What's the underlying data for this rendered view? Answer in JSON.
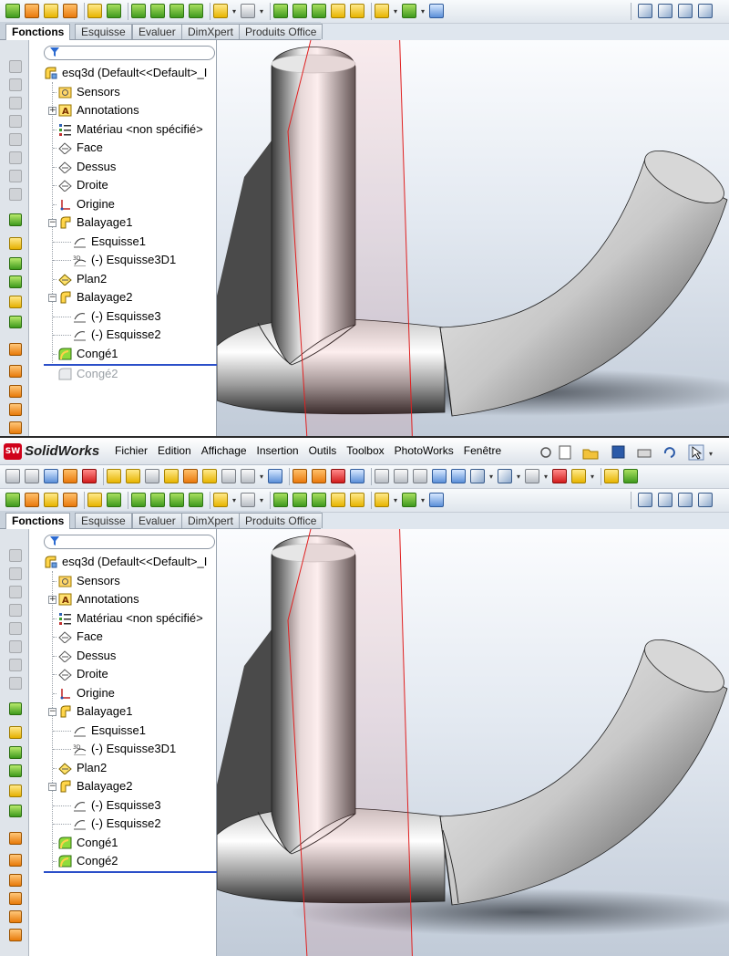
{
  "menubar": {
    "logo_mark": "SW",
    "app_name": "SolidWorks",
    "items": [
      "Fichier",
      "Edition",
      "Affichage",
      "Insertion",
      "Outils",
      "Toolbox",
      "PhotoWorks",
      "Fenêtre"
    ]
  },
  "command_manager": {
    "tabs": [
      "Fonctions",
      "Esquisse",
      "Evaluer",
      "DimXpert",
      "Produits Office"
    ],
    "active_tab": "Fonctions"
  },
  "feature_tree": {
    "root_label": "esq3d  (Default<<Default>_I",
    "top_panel_items": [
      {
        "label": "Sensors",
        "icon": "sensors-icon",
        "level": 1,
        "expander": ""
      },
      {
        "label": "Annotations",
        "icon": "annotations-icon",
        "level": 1,
        "expander": "+"
      },
      {
        "label": "Matériau <non spécifié>",
        "icon": "material-icon",
        "level": 1,
        "expander": ""
      },
      {
        "label": "Face",
        "icon": "plane-icon",
        "level": 1,
        "expander": ""
      },
      {
        "label": "Dessus",
        "icon": "plane-icon",
        "level": 1,
        "expander": ""
      },
      {
        "label": "Droite",
        "icon": "plane-icon",
        "level": 1,
        "expander": ""
      },
      {
        "label": "Origine",
        "icon": "origin-icon",
        "level": 1,
        "expander": ""
      },
      {
        "label": "Balayage1",
        "icon": "sweep-icon",
        "level": 1,
        "expander": "−"
      },
      {
        "label": "Esquisse1",
        "icon": "sketch-icon",
        "level": 2,
        "expander": ""
      },
      {
        "label": "(-) Esquisse3D1",
        "icon": "sketch3d-icon",
        "level": 2,
        "expander": ""
      },
      {
        "label": "Plan2",
        "icon": "plane-yellow-icon",
        "level": 1,
        "expander": ""
      },
      {
        "label": "Balayage2",
        "icon": "sweep-icon",
        "level": 1,
        "expander": "−"
      },
      {
        "label": "(-) Esquisse3",
        "icon": "sketch-icon",
        "level": 2,
        "expander": ""
      },
      {
        "label": "(-) Esquisse2",
        "icon": "sketch-icon",
        "level": 2,
        "expander": ""
      },
      {
        "label": "Congé1",
        "icon": "fillet-icon",
        "level": 1,
        "expander": ""
      }
    ],
    "top_panel_suppressed": "Congé2",
    "bottom_panel_items": [
      {
        "label": "Sensors",
        "icon": "sensors-icon",
        "level": 1,
        "expander": ""
      },
      {
        "label": "Annotations",
        "icon": "annotations-icon",
        "level": 1,
        "expander": "+"
      },
      {
        "label": "Matériau <non spécifié>",
        "icon": "material-icon",
        "level": 1,
        "expander": ""
      },
      {
        "label": "Face",
        "icon": "plane-icon",
        "level": 1,
        "expander": ""
      },
      {
        "label": "Dessus",
        "icon": "plane-icon",
        "level": 1,
        "expander": ""
      },
      {
        "label": "Droite",
        "icon": "plane-icon",
        "level": 1,
        "expander": ""
      },
      {
        "label": "Origine",
        "icon": "origin-icon",
        "level": 1,
        "expander": ""
      },
      {
        "label": "Balayage1",
        "icon": "sweep-icon",
        "level": 1,
        "expander": "−"
      },
      {
        "label": "Esquisse1",
        "icon": "sketch-icon",
        "level": 2,
        "expander": ""
      },
      {
        "label": "(-) Esquisse3D1",
        "icon": "sketch3d-icon",
        "level": 2,
        "expander": ""
      },
      {
        "label": "Plan2",
        "icon": "plane-yellow-icon",
        "level": 1,
        "expander": ""
      },
      {
        "label": "Balayage2",
        "icon": "sweep-icon",
        "level": 1,
        "expander": "−"
      },
      {
        "label": "(-) Esquisse3",
        "icon": "sketch-icon",
        "level": 2,
        "expander": ""
      },
      {
        "label": "(-) Esquisse2",
        "icon": "sketch-icon",
        "level": 2,
        "expander": ""
      },
      {
        "label": "Congé1",
        "icon": "fillet-icon",
        "level": 1,
        "expander": ""
      },
      {
        "label": "Congé2",
        "icon": "fillet-icon",
        "level": 1,
        "expander": ""
      }
    ]
  },
  "colors": {
    "accent_blue": "#2b4fc9",
    "plane_red": "#e02020",
    "tab_active_bg": "#ffffff"
  }
}
